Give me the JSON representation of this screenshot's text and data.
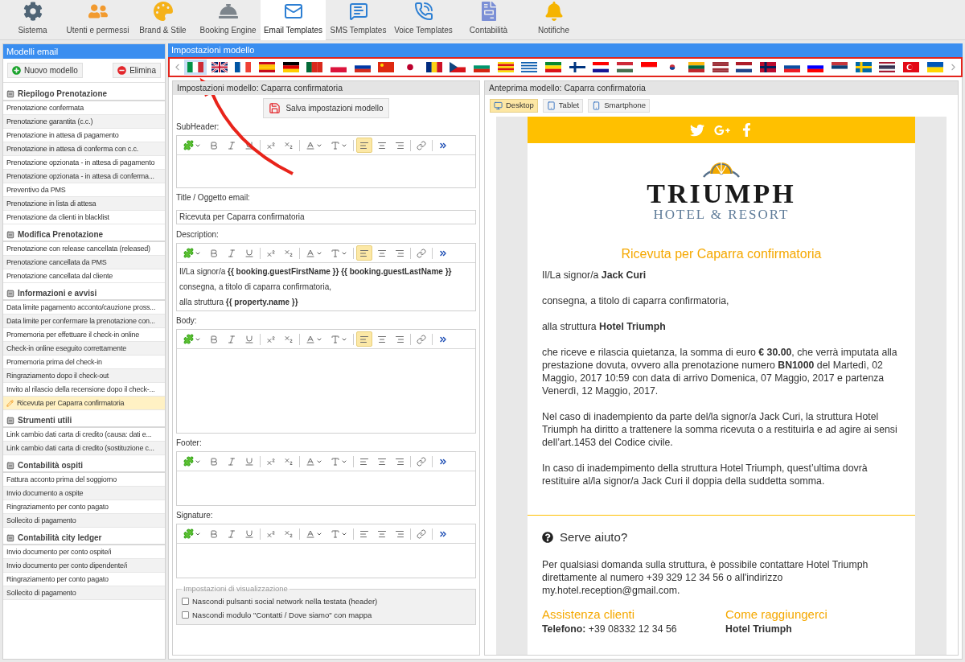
{
  "nav_tabs": [
    {
      "label": "Sistema",
      "selected": false
    },
    {
      "label": "Utenti e permessi",
      "selected": false
    },
    {
      "label": "Brand & Stile",
      "selected": false
    },
    {
      "label": "Booking Engine",
      "selected": false
    },
    {
      "label": "Email Templates",
      "selected": true
    },
    {
      "label": "SMS Templates",
      "selected": false
    },
    {
      "label": "Voice Templates",
      "selected": false
    },
    {
      "label": "Contabilità",
      "selected": false
    },
    {
      "label": "Notifiche",
      "selected": false
    }
  ],
  "sidebar": {
    "title": "Modelli email",
    "buttons": [
      {
        "label": "Nuovo modello",
        "kind": "add"
      },
      {
        "label": "Elimina",
        "kind": "delete"
      }
    ],
    "groups": [
      {
        "title": "Riepilogo Prenotazione",
        "expanded": true,
        "items": [
          {
            "label": "Prenotazione confermata",
            "selected": false
          },
          {
            "label": "Prenotazione garantita (c.c.)",
            "selected": false
          },
          {
            "label": "Prenotazione in attesa di pagamento",
            "selected": false
          },
          {
            "label": "Prenotazione in attesa di conferma con c.c.",
            "selected": false
          },
          {
            "label": "Prenotazione opzionata - in attesa di pagamento",
            "selected": false
          },
          {
            "label": "Prenotazione opzionata - in attesa di conferma...",
            "selected": false
          },
          {
            "label": "Preventivo da PMS",
            "selected": false
          },
          {
            "label": "Prenotazione in lista di attesa",
            "selected": false
          },
          {
            "label": "Prenotazione da clienti in blacklist",
            "selected": false
          }
        ]
      },
      {
        "title": "Modifica Prenotazione",
        "expanded": true,
        "items": [
          {
            "label": "Prenotazione con release cancellata (released)",
            "selected": false
          },
          {
            "label": "Prenotazione cancellata da PMS",
            "selected": false
          },
          {
            "label": "Prenotazione cancellata dal cliente",
            "selected": false
          }
        ]
      },
      {
        "title": "Informazioni e avvisi",
        "expanded": true,
        "items": [
          {
            "label": "Data limite pagamento acconto/cauzione pross...",
            "selected": false
          },
          {
            "label": "Data limite per confermare la prenotazione con...",
            "selected": false
          },
          {
            "label": "Promemoria per effettuare il check-in online",
            "selected": false
          },
          {
            "label": "Check-in online eseguito correttamente",
            "selected": false
          },
          {
            "label": "Promemoria prima del check-in",
            "selected": false
          },
          {
            "label": "Ringraziamento dopo il check-out",
            "selected": false
          },
          {
            "label": "Invito al rilascio della recensione dopo il check-...",
            "selected": false
          },
          {
            "label": "Ricevuta per Caparra confirmatoria",
            "selected": true
          }
        ]
      },
      {
        "title": "Strumenti utili",
        "expanded": true,
        "items": [
          {
            "label": "Link cambio dati carta di credito (causa: dati e...",
            "selected": false
          },
          {
            "label": "Link cambio dati carta di credito (sostituzione c...",
            "selected": false
          }
        ]
      },
      {
        "title": "Contabilità ospiti",
        "expanded": true,
        "items": [
          {
            "label": "Fattura acconto prima del soggiorno",
            "selected": false
          },
          {
            "label": "Invio documento a ospite",
            "selected": false
          },
          {
            "label": "Ringraziamento per conto pagato",
            "selected": false
          },
          {
            "label": "Sollecito di pagamento",
            "selected": false
          }
        ]
      },
      {
        "title": "Contabilità city ledger",
        "expanded": true,
        "items": [
          {
            "label": "Invio documento per conto ospite/i",
            "selected": false
          },
          {
            "label": "Invio documento per conto dipendente/i",
            "selected": false
          },
          {
            "label": "Ringraziamento per conto pagato",
            "selected": false
          },
          {
            "label": "Sollecito di pagamento",
            "selected": false
          }
        ]
      }
    ]
  },
  "main": {
    "title": "Impostazioni modello",
    "languages": [
      {
        "kind": "it",
        "selected": true
      },
      {
        "kind": "gb",
        "selected": false
      },
      {
        "kind": "fr",
        "selected": false
      },
      {
        "kind": "es",
        "selected": false
      },
      {
        "kind": "de",
        "selected": false
      },
      {
        "kind": "pt",
        "selected": false
      },
      {
        "kind": "pl",
        "selected": false
      },
      {
        "kind": "ru",
        "selected": false
      },
      {
        "kind": "cn",
        "selected": false
      },
      {
        "kind": "jp",
        "selected": false
      },
      {
        "kind": "ro",
        "selected": false
      },
      {
        "kind": "cz",
        "selected": false
      },
      {
        "kind": "bg",
        "selected": false
      },
      {
        "kind": "ca",
        "selected": false
      },
      {
        "kind": "gr",
        "selected": false
      },
      {
        "kind": "et",
        "selected": false
      },
      {
        "kind": "fi",
        "selected": false
      },
      {
        "kind": "hr",
        "selected": false
      },
      {
        "kind": "hu",
        "selected": false
      },
      {
        "kind": "id",
        "selected": false
      },
      {
        "kind": "kr",
        "selected": false
      },
      {
        "kind": "lt",
        "selected": false
      },
      {
        "kind": "lv",
        "selected": false
      },
      {
        "kind": "nl",
        "selected": false
      },
      {
        "kind": "no",
        "selected": false
      },
      {
        "kind": "sk",
        "selected": false
      },
      {
        "kind": "si",
        "selected": false
      },
      {
        "kind": "rs",
        "selected": false
      },
      {
        "kind": "se",
        "selected": false
      },
      {
        "kind": "th",
        "selected": false
      },
      {
        "kind": "tr",
        "selected": false
      },
      {
        "kind": "ua",
        "selected": false
      }
    ]
  },
  "settings": {
    "title": "Impostazioni modello: Caparra confirmatoria",
    "save_button": "Salva impostazioni modello",
    "fields": [
      {
        "kind": "editor",
        "label": "SubHeader:",
        "left_align_active": true
      },
      {
        "kind": "input",
        "label": "Title / Oggetto email:",
        "value": "Ricevuta per Caparra confirmatoria"
      },
      {
        "kind": "editor",
        "label": "Description:",
        "left_align_active": true,
        "lines": [
          "Il/La signor/a **{{ booking.guestFirstName }}** **{{ booking.guestLastName }}**",
          "consegna, a titolo di caparra confirmatoria,",
          "alla struttura **{{ property.name }}**"
        ]
      },
      {
        "kind": "editor",
        "label": "Body:",
        "left_align_active": true
      },
      {
        "kind": "editor",
        "label": "Footer:",
        "left_align_active": false
      },
      {
        "kind": "editor",
        "label": "Signature:",
        "left_align_active": false
      }
    ],
    "display_settings": {
      "legend": "Impostazioni di visualizzazione",
      "options": [
        {
          "label": "Nascondi pulsanti social network nella testata (header)",
          "checked": false
        },
        {
          "label": "Nascondi modulo \"Contatti / Dove siamo\" con mappa",
          "checked": false
        }
      ]
    }
  },
  "preview": {
    "title": "Anteprima modello: Caparra confirmatoria",
    "devices": [
      {
        "label": "Desktop",
        "selected": true
      },
      {
        "label": "Tablet",
        "selected": false
      },
      {
        "label": "Smartphone",
        "selected": false
      }
    ],
    "email": {
      "social": [
        {
          "kind": "twitter"
        },
        {
          "kind": "google-plus"
        },
        {
          "kind": "facebook"
        }
      ],
      "logo": {
        "name": "TRIUMPH",
        "tagline": "HOTEL & RESORT"
      },
      "heading": "Ricevuta per Caparra confirmatoria",
      "paragraphs": [
        "Il/La signor/a **Jack Curi**",
        "consegna, a titolo di caparra confirmatoria,",
        "alla struttura **Hotel Triumph**",
        "che riceve e rilascia quietanza, la somma di euro **€ 30.00**, che verrà imputata alla prestazione dovuta, ovvero alla prenotazione numero **BN1000** del Martedì, 02 Maggio, 2017 10:59 con data di arrivo Domenica, 07 Maggio, 2017 e partenza Venerdì, 12 Maggio, 2017.",
        "Nel caso di inadempiento da parte del/la signor/a Jack Curi, la struttura Hotel Triumph ha diritto a trattenere la somma ricevuta o a restituirla e ad agire ai sensi dell’art.1453 del Codice civile.",
        "In caso di inadempimento della struttura Hotel Triumph, quest’ultima dovrà restituire al/la signor/a Jack Curi il doppia della suddetta somma."
      ],
      "help": {
        "title": "Serve aiuto?",
        "text": "Per qualsiasi domanda sulla struttura, è possibile contattare Hotel Triumph direttamente al numero +39 329 12 34 56 o all'indirizzo my.hotel.reception@gmail.com."
      },
      "columns": [
        {
          "title": "Assistenza clienti",
          "line_label": "Telefono:",
          "line": "+39 08332 12 34 56"
        },
        {
          "title": "Come raggiungerci",
          "line_label": "Hotel Triumph"
        }
      ]
    }
  }
}
